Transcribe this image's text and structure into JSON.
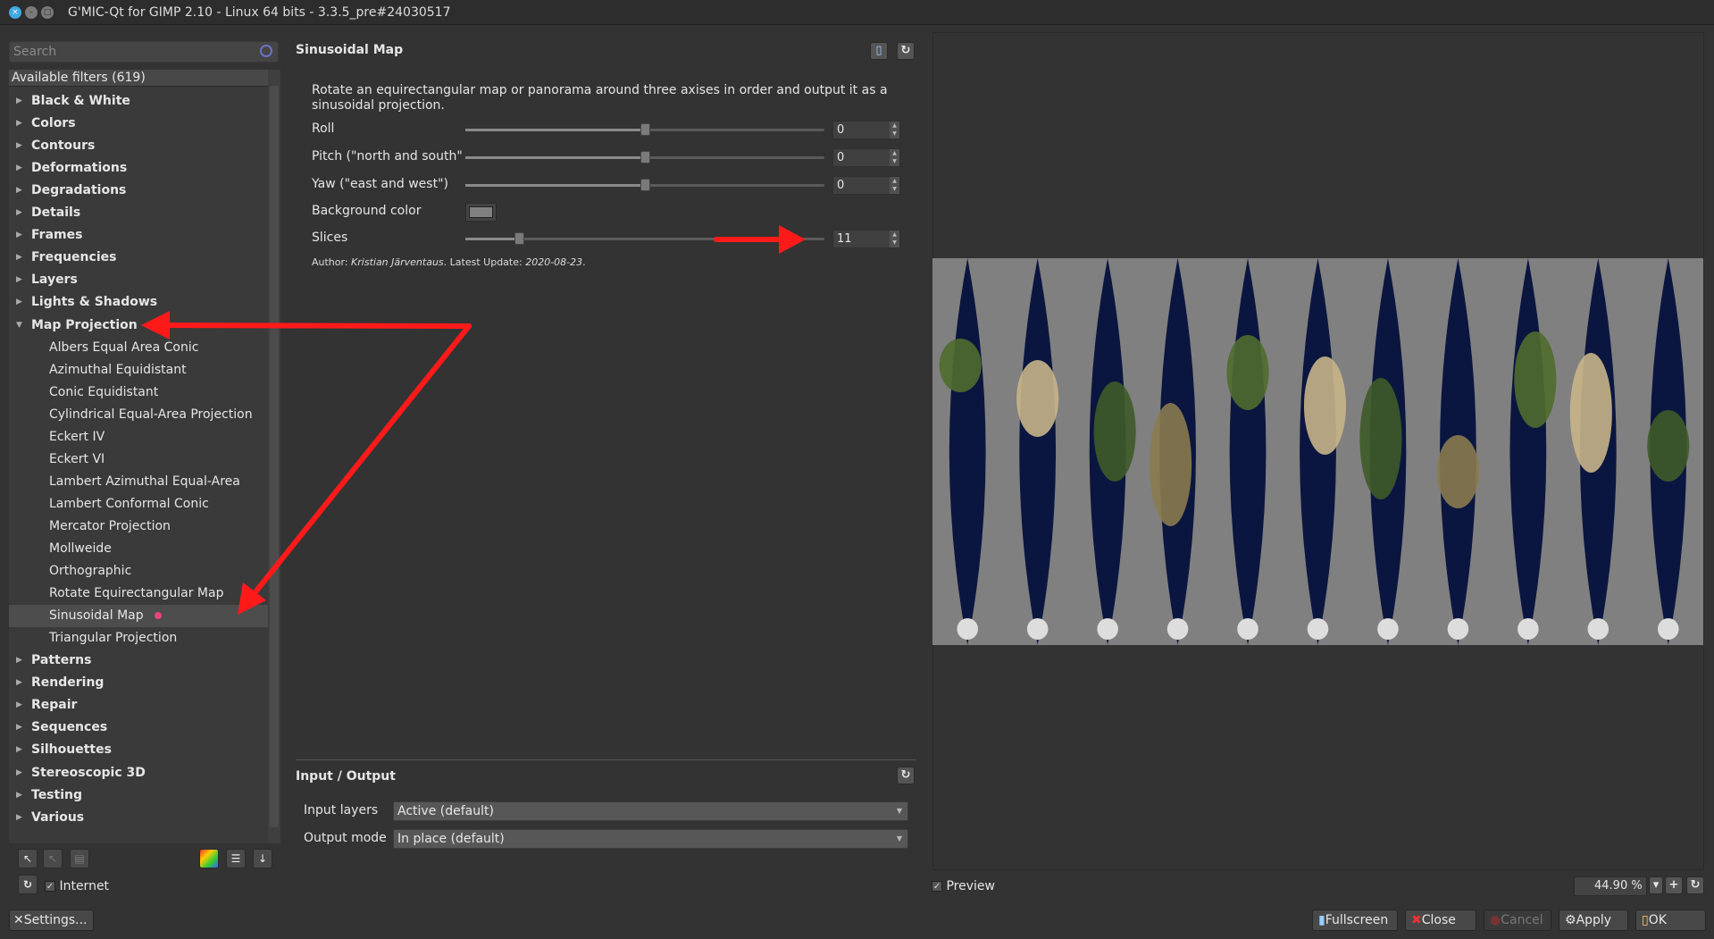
{
  "window": {
    "title": "G'MIC-Qt for GIMP 2.10 - Linux 64 bits - 3.3.5_pre#24030517"
  },
  "sidebar": {
    "search_placeholder": "Search",
    "header": "Available filters (619)",
    "categories_top": [
      "Black & White",
      "Colors",
      "Contours",
      "Deformations",
      "Degradations",
      "Details",
      "Frames",
      "Frequencies",
      "Layers",
      "Lights & Shadows"
    ],
    "expanded": "Map Projection",
    "filters": [
      "Albers Equal Area Conic",
      "Azimuthal Equidistant",
      "Conic Equidistant",
      "Cylindrical Equal-Area Projection",
      "Eckert IV",
      "Eckert VI",
      "Lambert Azimuthal Equal-Area",
      "Lambert Conformal Conic",
      "Mercator Projection",
      "Mollweide",
      "Orthographic",
      "Rotate Equirectangular Map",
      "Sinusoidal Map",
      "Triangular Projection"
    ],
    "selected": "Sinusoidal Map",
    "categories_bottom": [
      "Patterns",
      "Rendering",
      "Repair",
      "Sequences",
      "Silhouettes",
      "Stereoscopic 3D",
      "Testing",
      "Various"
    ],
    "internet_label": "Internet",
    "settings_label": "Settings..."
  },
  "filter": {
    "title": "Sinusoidal Map",
    "description": "Rotate an equirectangular map or panorama around three axises in order and output it as a sinusoidal projection.",
    "params": [
      {
        "label": "Roll",
        "value": "0",
        "fraction": 0.5
      },
      {
        "label": "Pitch (\"north and south\"",
        "value": "0",
        "fraction": 0.5
      },
      {
        "label": "Yaw (\"east and west\")",
        "value": "0",
        "fraction": 0.5
      }
    ],
    "bg_label": "Background color",
    "bg_color": "#808080",
    "slices": {
      "label": "Slices",
      "value": "11",
      "fraction": 0.15
    },
    "author_prefix": "Author: ",
    "author": "Kristian Järventaus",
    "update_prefix": ". Latest Update: ",
    "update": "2020-08-23",
    "update_suffix": "."
  },
  "io": {
    "title": "Input / Output",
    "input_label": "Input layers",
    "input_value": "Active (default)",
    "output_label": "Output mode",
    "output_value": "In place (default)"
  },
  "preview": {
    "label": "Preview",
    "zoom": "44.90 %",
    "slices": 11
  },
  "buttons": {
    "fullscreen": "Fullscreen",
    "close": "Close",
    "cancel": "Cancel",
    "apply": "Apply",
    "ok": "OK"
  }
}
